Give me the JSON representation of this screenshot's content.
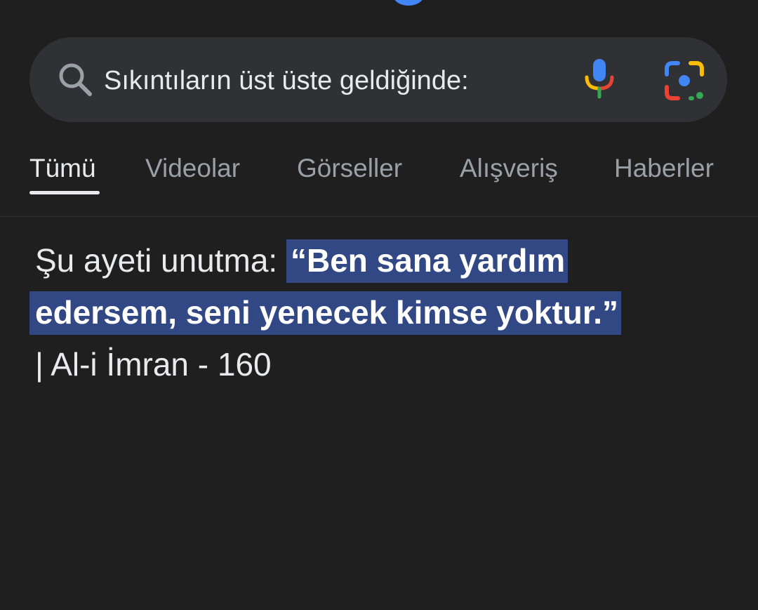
{
  "search": {
    "query": "Sıkıntıların üst üste geldiğinde:",
    "icons": {
      "search": "search-icon",
      "voice": "mic-icon",
      "lens": "google-lens-icon"
    }
  },
  "tabs": [
    {
      "label": "Tümü",
      "active": true
    },
    {
      "label": "Videolar",
      "active": false
    },
    {
      "label": "Görseller",
      "active": false
    },
    {
      "label": "Alışveriş",
      "active": false
    },
    {
      "label": "Haberler",
      "active": false
    }
  ],
  "answer": {
    "intro": "Şu ayeti unutma: ",
    "highlight_line1": "“Ben sana yardım",
    "highlight_line2": "edersem, seni yenecek kimse yoktur.”",
    "source": "| Al-i İmran - 160"
  },
  "colors": {
    "background": "#1f1f1f",
    "search_bar": "#303134",
    "highlight": "#324884",
    "text_primary": "#e8eaed",
    "text_secondary": "#9aa0a6",
    "google_blue": "#4285f4",
    "google_red": "#ea4335",
    "google_yellow": "#fbbc05",
    "google_green": "#34a853"
  }
}
